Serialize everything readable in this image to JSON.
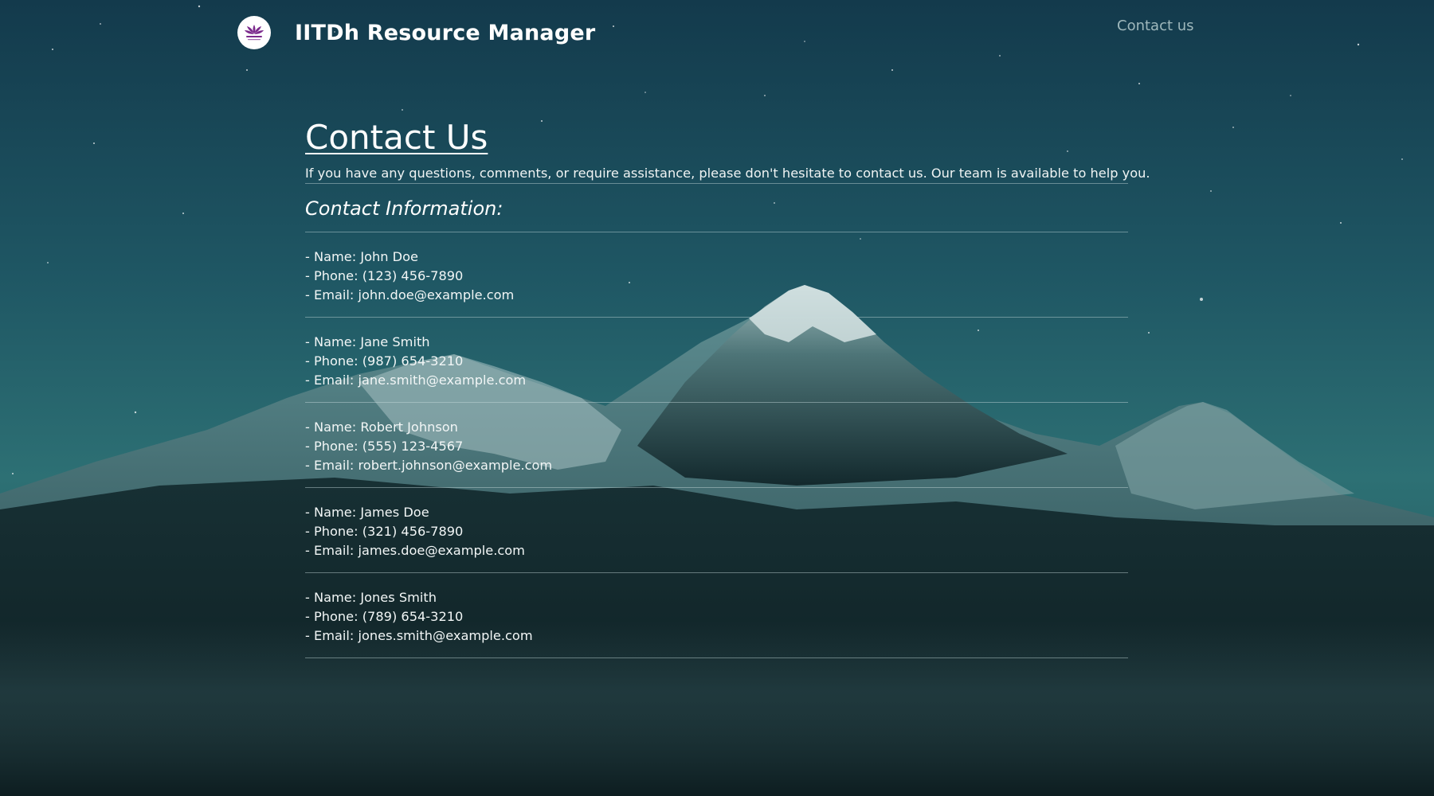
{
  "colors": {
    "sky_top": "#143c4e",
    "sky_mid": "#2b6b70",
    "mountain_dark": "#10282d",
    "snow": "#c9d8d8",
    "text": "#ffffff",
    "nav_link": "#9fb8bc",
    "logo_accent": "#7b2a8c"
  },
  "header": {
    "brand_title": "IITDh Resource Manager",
    "logo_icon": "iitdh-logo-icon",
    "nav_contact": "Contact us"
  },
  "main": {
    "title": "Contact Us",
    "intro": "If you have any questions, comments, or require assistance, please don't hesitate to contact us. Our team is available to help you.",
    "section_heading": "Contact Information:",
    "contacts": [
      {
        "name": "- Name: John Doe",
        "phone": "- Phone: (123) 456-7890",
        "email": "- Email: john.doe@example.com"
      },
      {
        "name": "- Name: Jane Smith",
        "phone": "- Phone: (987) 654-3210",
        "email": "- Email: jane.smith@example.com"
      },
      {
        "name": "- Name: Robert Johnson",
        "phone": "- Phone: (555) 123-4567",
        "email": "- Email: robert.johnson@example.com"
      },
      {
        "name": "- Name: James Doe",
        "phone": "- Phone: (321) 456-7890",
        "email": "- Email: james.doe@example.com"
      },
      {
        "name": "- Name: Jones Smith",
        "phone": "- Phone: (789) 654-3210",
        "email": "- Email: jones.smith@example.com"
      }
    ]
  }
}
